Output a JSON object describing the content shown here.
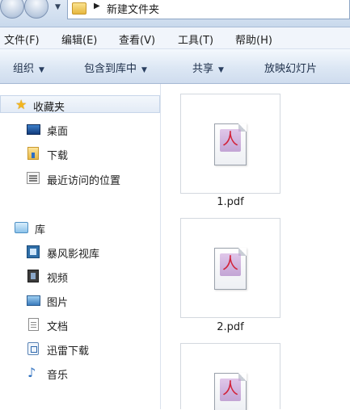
{
  "address": {
    "path": "新建文件夹"
  },
  "menu": {
    "items": [
      "文件(F)",
      "编辑(E)",
      "查看(V)",
      "工具(T)",
      "帮助(H)"
    ]
  },
  "toolbar": {
    "organize": "组织",
    "include_in_library": "包含到库中",
    "share": "共享",
    "slideshow": "放映幻灯片"
  },
  "nav": {
    "favorites": {
      "label": "收藏夹",
      "items": [
        "桌面",
        "下载",
        "最近访问的位置"
      ]
    },
    "libraries": {
      "label": "库",
      "items": [
        "暴风影视库",
        "视频",
        "图片",
        "文档",
        "迅雷下载",
        "音乐"
      ]
    }
  },
  "files": [
    {
      "name": "1.pdf"
    },
    {
      "name": "2.pdf"
    },
    {
      "name": ""
    }
  ],
  "colors": {
    "pdf_red": "#d2233a",
    "favorites_star": "#f2b51e",
    "toolbar_text": "#1e2f4a"
  }
}
